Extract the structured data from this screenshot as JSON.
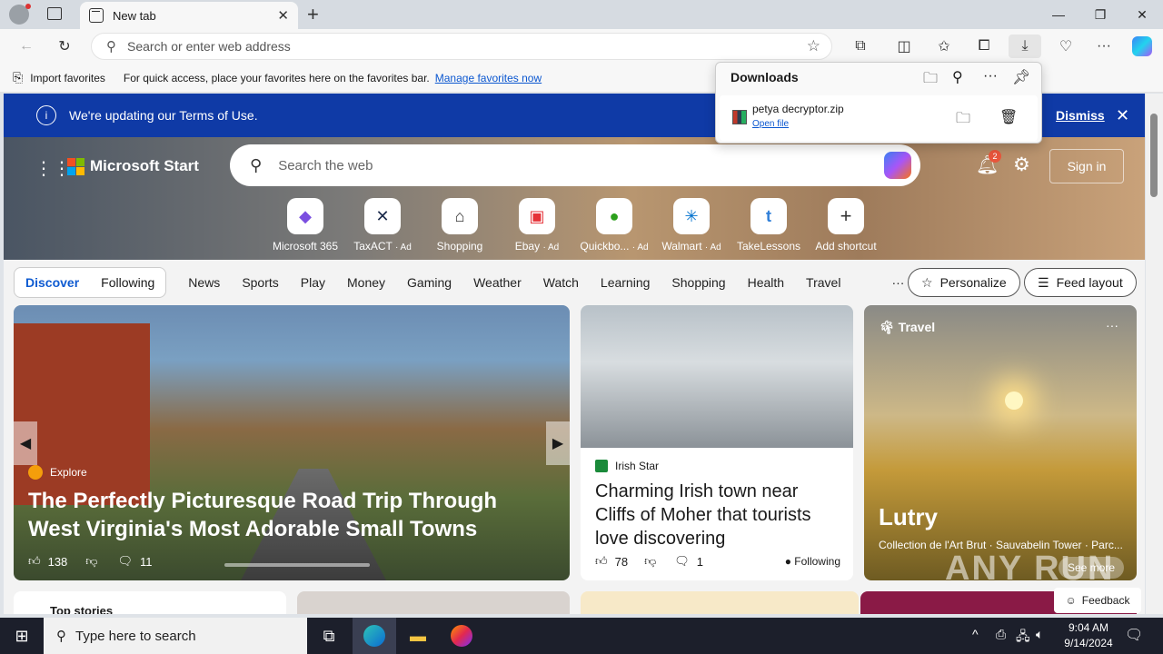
{
  "browser": {
    "tab_title": "New tab",
    "address_placeholder": "Search or enter web address",
    "favorites_import": "Import favorites",
    "favorites_hint": "For quick access, place your favorites here on the favorites bar.",
    "favorites_link": "Manage favorites now"
  },
  "downloads": {
    "title": "Downloads",
    "file_name": "petya decryptor.zip",
    "open_file": "Open file"
  },
  "terms_banner": {
    "message": "We're updating our Terms of Use.",
    "dismiss": "Dismiss"
  },
  "header": {
    "brand": "Microsoft Start",
    "search_placeholder": "Search the web",
    "notification_count": "2",
    "sign_in": "Sign in"
  },
  "quick_links": [
    {
      "label": "Microsoft 365",
      "ad": ""
    },
    {
      "label": "TaxACT",
      "ad": "· Ad"
    },
    {
      "label": "Shopping",
      "ad": ""
    },
    {
      "label": "Ebay",
      "ad": "· Ad"
    },
    {
      "label": "Quickbo...",
      "ad": "· Ad"
    },
    {
      "label": "Walmart",
      "ad": "· Ad"
    },
    {
      "label": "TakeLessons",
      "ad": ""
    },
    {
      "label": "Add shortcut",
      "ad": ""
    }
  ],
  "nav": {
    "discover": "Discover",
    "following": "Following",
    "items": [
      "News",
      "Sports",
      "Play",
      "Money",
      "Gaming",
      "Weather",
      "Watch",
      "Learning",
      "Shopping",
      "Health",
      "Travel"
    ],
    "more": "···",
    "personalize": "Personalize",
    "feed_layout": "Feed layout"
  },
  "main_card": {
    "source": "Explore",
    "title": "The Perfectly Picturesque Road Trip Through West Virginia's Most Adorable Small Towns",
    "likes": "138",
    "comments": "11"
  },
  "irish_card": {
    "source": "Irish Star",
    "title": "Charming Irish town near Cliffs of Moher that tourists love discovering",
    "likes": "78",
    "comments": "1",
    "following": "Following"
  },
  "travel_card": {
    "category": "Travel",
    "title": "Lutry",
    "subtitle": "Collection de l'Art Brut · Sauvabelin Tower · Parc...",
    "see_more": "See more"
  },
  "bottom": {
    "top_stories": "Top stories",
    "feedback": "Feedback"
  },
  "taskbar": {
    "search_placeholder": "Type here to search",
    "time": "9:04 AM",
    "date": "9/14/2024"
  },
  "watermark": "ANY RUN"
}
